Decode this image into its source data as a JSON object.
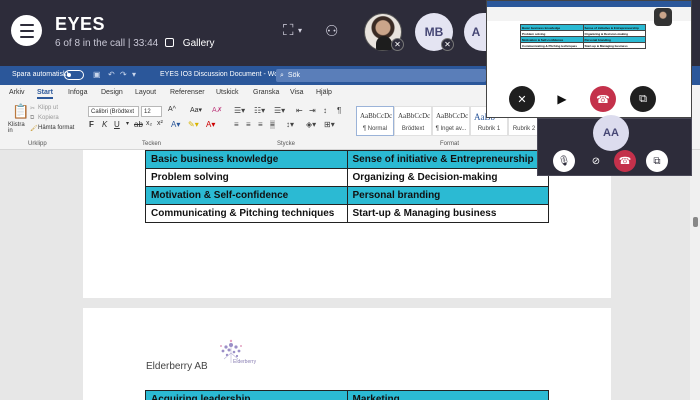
{
  "call": {
    "title": "EYES",
    "subtitle": "6 of 8 in the call | 33:44",
    "view_label": "Gallery",
    "participants": [
      {
        "initials": "MB"
      },
      {
        "initials": "A"
      }
    ],
    "self_initials": "AA"
  },
  "word": {
    "autosave_label": "Spara automatiskt",
    "document_name": "EYES IO3 Discussion Document  -  Word",
    "search_placeholder": "Sök",
    "tabs": [
      "Arkiv",
      "Start",
      "Infoga",
      "Design",
      "Layout",
      "Referenser",
      "Utskick",
      "Granska",
      "Visa",
      "Hjälp"
    ],
    "active_tab": "Start",
    "ribbon": {
      "paste_label": "Klistra in",
      "cut_label": "Klipp ut",
      "copy_label": "Kopiera",
      "format_painter_label": "Hämta format",
      "font_name": "Calibri (Brödtext",
      "font_size": "12",
      "groups": {
        "clipboard": "Urklipp",
        "font": "Tecken",
        "paragraph": "Stycke",
        "styles": "Format"
      },
      "styles": [
        {
          "preview": "AaBbCcDc",
          "name": "¶ Normal"
        },
        {
          "preview": "AaBbCcDc",
          "name": "Brödtext"
        },
        {
          "preview": "AaBbCcDc",
          "name": "¶ Inget av..."
        },
        {
          "preview": "AaBb",
          "name": "Rubrik 1"
        },
        {
          "preview": "AaBbC",
          "name": "Rubrik 2"
        }
      ]
    }
  },
  "document": {
    "table1": [
      [
        "Basic business knowledge",
        "Sense of initiative & Entrepreneurship"
      ],
      [
        "Problem solving",
        "Organizing & Decision-making"
      ],
      [
        "Motivation & Self-confidence",
        "Personal branding"
      ],
      [
        "Communicating & Pitching techniques",
        "Start-up & Managing business"
      ]
    ],
    "logo_company": "Elderberry AB",
    "logo_sub": "Elderberry",
    "table2_row1": [
      "Acquiring leadership",
      "Marketing"
    ]
  },
  "colors": {
    "teams_bar": "#2d2c3a",
    "word_blue": "#2b579a",
    "table_highlight": "#2bbad3",
    "hangup_red": "#c4314b"
  }
}
